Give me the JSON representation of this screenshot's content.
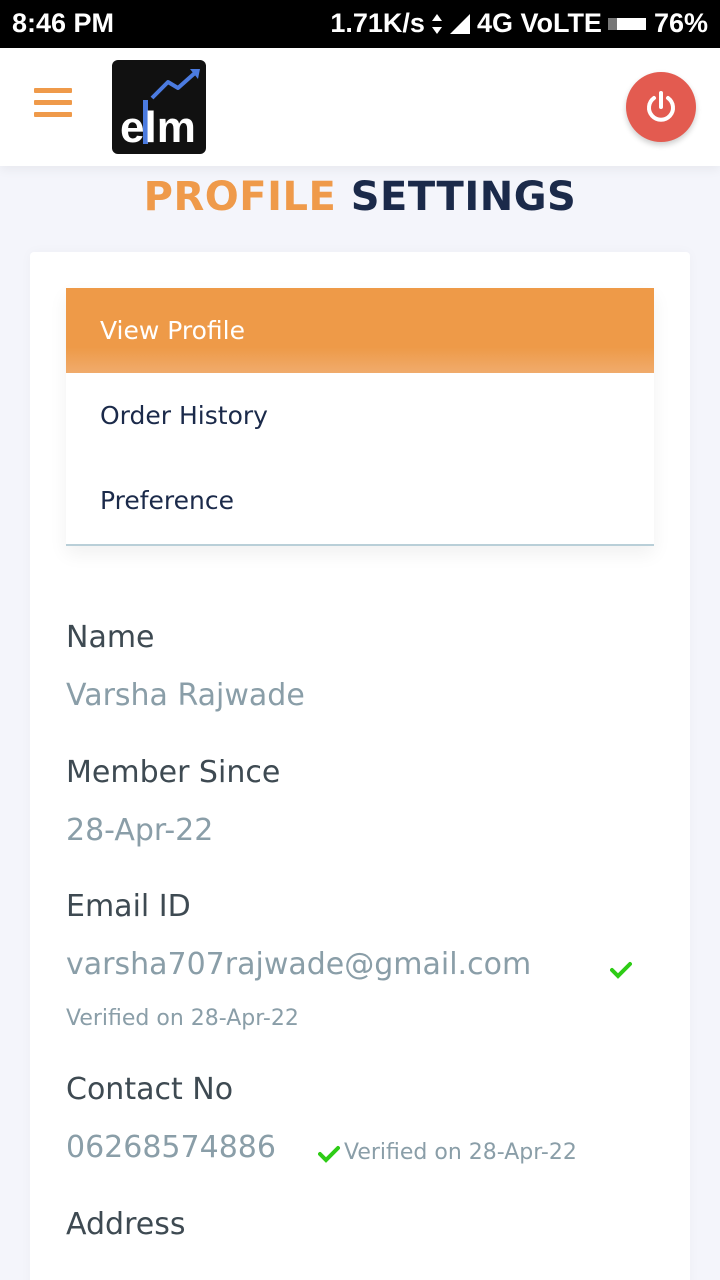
{
  "status": {
    "time": "8:46 PM",
    "speed": "1.71K/s",
    "network": "4G VoLTE",
    "battery": "76%"
  },
  "app": {
    "logo_text": "elm"
  },
  "title": {
    "part1": "PROFILE",
    "part2": "SETTINGS"
  },
  "menu": {
    "items": [
      {
        "label": "View Profile"
      },
      {
        "label": "Order History"
      },
      {
        "label": "Preference"
      }
    ]
  },
  "profile": {
    "name_label": "Name",
    "name_value": "Varsha Rajwade",
    "member_label": "Member Since",
    "member_value": "28-Apr-22",
    "email_label": "Email ID",
    "email_value": "varsha707rajwade@gmail.com",
    "email_verified": "Verified on 28-Apr-22",
    "contact_label": "Contact No",
    "contact_value": "06268574886",
    "contact_verified": "Verified on 28-Apr-22",
    "address_label": "Address"
  },
  "colors": {
    "accent": "#ef9a4a",
    "navy": "#1b2a4a",
    "power": "#e35b50",
    "verified": "#2ecc16"
  }
}
